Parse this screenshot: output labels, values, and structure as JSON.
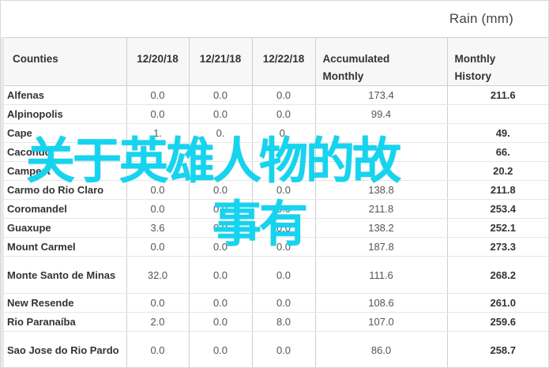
{
  "header": {
    "title": "Rain (mm)"
  },
  "table": {
    "columns": {
      "county": "Counties",
      "d1": "12/20/18",
      "d2": "12/21/18",
      "d3": "12/22/18",
      "acc_line1": "Accumulated",
      "acc_line2": "Monthly",
      "hist_line1": "Monthly",
      "hist_line2": "History"
    },
    "rows": [
      {
        "county": "Alfenas",
        "d1": "0.0",
        "d2": "0.0",
        "d3": "0.0",
        "acc": "173.4",
        "hist": "211.6"
      },
      {
        "county": "Alpinopolis",
        "d1": "0.0",
        "d2": "0.0",
        "d3": "0.0",
        "acc": "99.4",
        "hist": ""
      },
      {
        "county": "Cape",
        "d1": "1.",
        "d2": "0.",
        "d3": "0.",
        "acc": "",
        "hist": "49."
      },
      {
        "county": "Cacondo",
        "d1": "",
        "d2": "",
        "d3": "",
        "acc": "",
        "hist": "66."
      },
      {
        "county": "Campest",
        "d1": "",
        "d2": "",
        "d3": "",
        "acc": "",
        "hist": "20.2"
      },
      {
        "county": "Carmo do Rio Claro",
        "d1": "0.0",
        "d2": "0.0",
        "d3": "0.0",
        "acc": "138.8",
        "hist": "211.8"
      },
      {
        "county": "Coromandel",
        "d1": "0.0",
        "d2": "0.0",
        "d3": "0.0",
        "acc": "211.8",
        "hist": "253.4"
      },
      {
        "county": "Guaxupe",
        "d1": "3.6",
        "d2": "0.0",
        "d3": "0.0",
        "acc": "138.2",
        "hist": "252.1"
      },
      {
        "county": "Mount Carmel",
        "d1": "0.0",
        "d2": "0.0",
        "d3": "0.0",
        "acc": "187.8",
        "hist": "273.3"
      },
      {
        "county": "Monte Santo de Minas",
        "d1": "32.0",
        "d2": "0.0",
        "d3": "0.0",
        "acc": "111.6",
        "hist": "268.2",
        "tall": true
      },
      {
        "county": "New Resende",
        "d1": "0.0",
        "d2": "0.0",
        "d3": "0.0",
        "acc": "108.6",
        "hist": "261.0"
      },
      {
        "county": "Rio Paranaíba",
        "d1": "2.0",
        "d2": "0.0",
        "d3": "8.0",
        "acc": "107.0",
        "hist": "259.6"
      },
      {
        "county": "Sao Jose do Rio Pardo",
        "d1": "0.0",
        "d2": "0.0",
        "d3": "0.0",
        "acc": "86.0",
        "hist": "258.7",
        "tall": true
      }
    ]
  },
  "overlay": {
    "line1": "关于英雄人物的故",
    "line2": "事有",
    "color": "#15d4f0"
  }
}
